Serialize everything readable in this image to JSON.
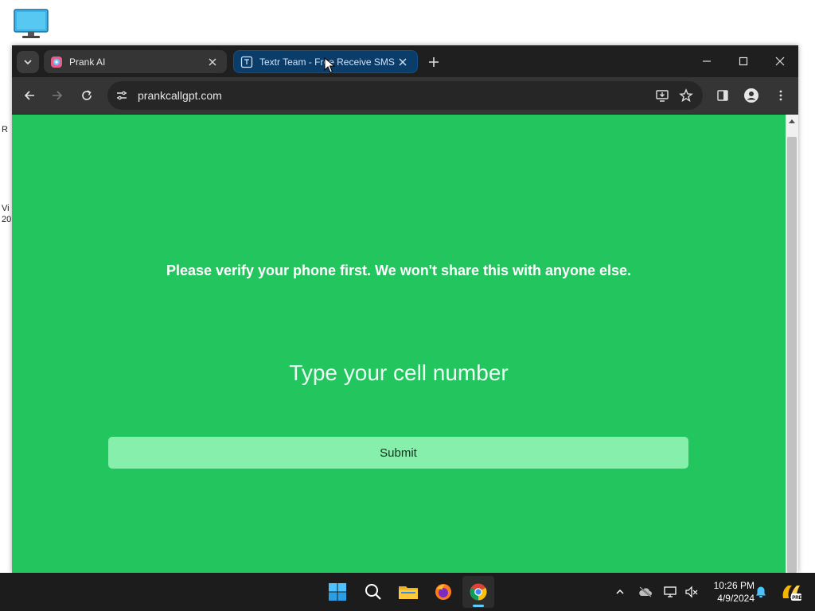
{
  "desktop": {
    "edge_texts": [
      "R",
      "Vi",
      "20"
    ]
  },
  "browser": {
    "tabs": [
      {
        "title": "Prank AI",
        "icon": "prank-ai-favicon",
        "active": true
      },
      {
        "title": "Textr Team - Free Receive SMS",
        "icon": "textr-favicon",
        "active": false
      }
    ],
    "url": "prankcallgpt.com"
  },
  "page": {
    "message": "Please verify your phone first. We won't share this with anyone else.",
    "phone_placeholder": "Type your cell number",
    "phone_value": "",
    "submit_label": "Submit",
    "colors": {
      "background": "#22c55e",
      "button": "#86efac",
      "text": "#ffffff"
    }
  },
  "taskbar": {
    "apps": [
      "start-icon",
      "search-icon",
      "file-explorer-icon",
      "firefox-icon",
      "chrome-icon"
    ],
    "active_app": "chrome-icon",
    "time": "10:26 PM",
    "date": "4/9/2024"
  }
}
